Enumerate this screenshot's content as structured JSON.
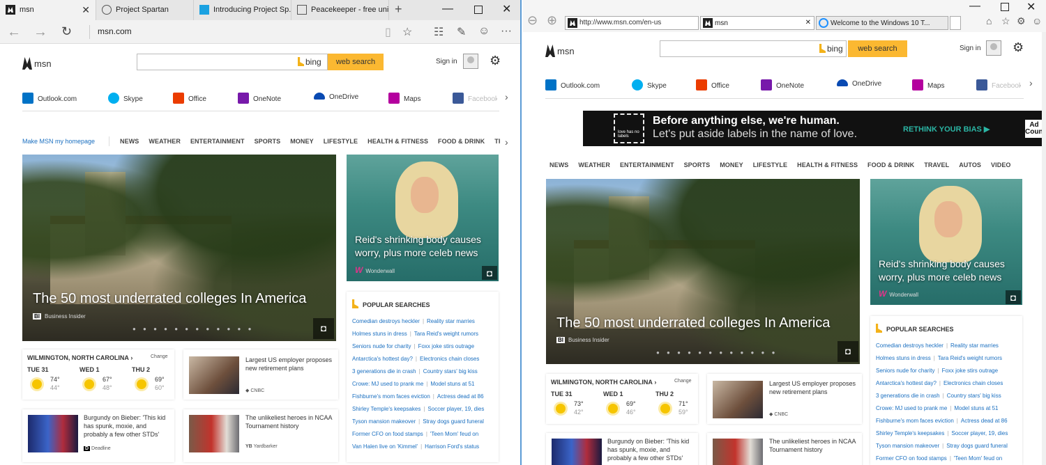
{
  "edge": {
    "tabs": [
      {
        "label": "msn",
        "icon": "msn-icon"
      },
      {
        "label": "Project Spartan",
        "icon": "globe-icon"
      },
      {
        "label": "Introducing Project Sp...",
        "icon": "page-icon"
      },
      {
        "label": "Peacekeeper - free uni...",
        "icon": "document-icon"
      }
    ],
    "new_tab": "+",
    "url": "msn.com"
  },
  "ie": {
    "url": "http://www.msn.com/en-us",
    "tabs": [
      {
        "label": "msn"
      },
      {
        "label": "Welcome to the Windows 10 T..."
      }
    ]
  },
  "msn": {
    "logo": "msn",
    "bing_label": "bing",
    "search_button": "web search",
    "sign_in": "Sign in",
    "services": [
      "Outlook.com",
      "Skype",
      "Office",
      "OneNote",
      "OneDrive",
      "Maps",
      "Facebook"
    ],
    "make_homepage": "Make MSN my homepage",
    "nav_left": [
      "NEWS",
      "WEATHER",
      "ENTERTAINMENT",
      "SPORTS",
      "MONEY",
      "LIFESTYLE",
      "HEALTH & FITNESS",
      "FOOD & DRINK",
      "TRAVEL"
    ],
    "nav_right": [
      "NEWS",
      "WEATHER",
      "ENTERTAINMENT",
      "SPORTS",
      "MONEY",
      "LIFESTYLE",
      "HEALTH & FITNESS",
      "FOOD & DRINK",
      "TRAVEL",
      "AUTOS",
      "VIDEO"
    ],
    "hero": {
      "title": "The 50 most underrated colleges In America",
      "source": "Business Insider",
      "source_abbr": "BI",
      "dots": "● ● ● ● ● ● ● ● ● ● ● ●"
    },
    "celeb": {
      "title": "Reid's shrinking body causes worry, plus more celeb news",
      "source": "Wonderwall"
    },
    "popular_title": "POPULAR SEARCHES",
    "popular": [
      [
        "Comedian destroys heckler",
        "Reality star marries"
      ],
      [
        "Holmes stuns in dress",
        "Tara Reid's weight rumors"
      ],
      [
        "Seniors nude for charity",
        "Foxx joke stirs outrage"
      ],
      [
        "Antarctica's hottest day?",
        "Electronics chain closes"
      ],
      [
        "3 generations die in crash",
        "Country stars' big kiss"
      ],
      [
        "Crowe: MJ used to prank me",
        "Model stuns at 51"
      ],
      [
        "Fishburne's mom faces eviction",
        "Actress dead at 86"
      ],
      [
        "Shirley Temple's keepsakes",
        "Soccer player, 19, dies"
      ],
      [
        "Tyson mansion makeover",
        "Stray dogs guard funeral"
      ],
      [
        "Former CFO on food stamps",
        "'Teen Mom' feud on"
      ],
      [
        "Van Halen live on 'Kimmel'",
        "Harrison Ford's status"
      ]
    ],
    "weather": {
      "location": "WILMINGTON, NORTH CAROLINA",
      "change": "Change",
      "left_days": [
        {
          "day": "TUE 31",
          "hi": "74°",
          "lo": "44°"
        },
        {
          "day": "WED 1",
          "hi": "67°",
          "lo": "48°"
        },
        {
          "day": "THU 2",
          "hi": "69°",
          "lo": "60°"
        }
      ],
      "right_days": [
        {
          "day": "TUE 31",
          "hi": "73°",
          "lo": "42°"
        },
        {
          "day": "WED 1",
          "hi": "69°",
          "lo": "46°"
        },
        {
          "day": "THU 2",
          "hi": "71°",
          "lo": "59°"
        }
      ]
    },
    "stories": [
      {
        "title": "Largest US employer proposes new retirement plans",
        "source": "CNBC"
      },
      {
        "title": "Burgundy on Bieber: 'This kid has spunk, moxie, and probably a few other STDs'",
        "source": "Deadline"
      },
      {
        "title": "The unlikeliest heroes in NCAA Tournament history",
        "source": "Yardbarker"
      }
    ],
    "ad": {
      "headline": "Before anything else, we're human.",
      "sub": "Let's put aside labels in the name of love.",
      "cta": "RETHINK YOUR BIAS ▶",
      "badge_left": "love has no labels",
      "badge_right": "Ad Council"
    }
  }
}
